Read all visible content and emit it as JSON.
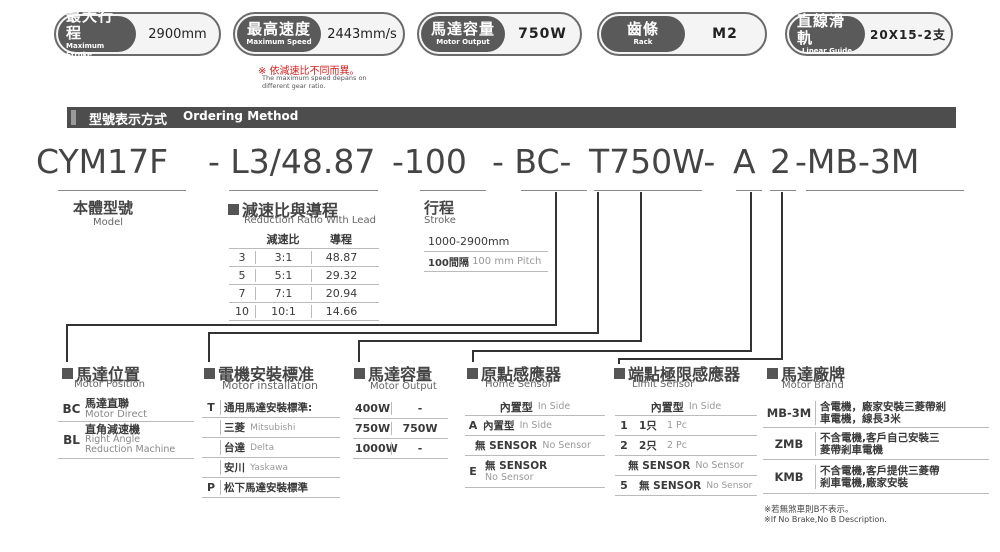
{
  "specs": [
    {
      "label": "最大行程",
      "label_en": "Maximum Stroke",
      "value": "2900mm"
    },
    {
      "label": "最高速度",
      "label_en": "Maximum Speed",
      "value": "2443mm/s"
    },
    {
      "label": "馬達容量",
      "label_en": "Motor Output",
      "value": "750W"
    },
    {
      "label": "齒條",
      "label_en": "Rack",
      "value": "M2"
    },
    {
      "label": "直線滑軌",
      "label_en": "Linear Guide",
      "value": "20X15-2支"
    }
  ],
  "speed_note": {
    "zh": "※ 依減速比不同而異。",
    "en1": "The maximum speed depans on",
    "en2": "different gear ratio."
  },
  "ordering": {
    "zh": "型號表示方式",
    "en": "Ordering Method"
  },
  "code_parts": [
    "CYM17F",
    "- L3/48.87",
    "-100",
    "- BC-",
    "T750W-",
    "A",
    "2",
    "-MB-3M"
  ],
  "model": {
    "zh": "本體型號",
    "en": "Model"
  },
  "reduction": {
    "title": "減速比與導程",
    "sub": "Reduction Ratio With Lead",
    "headers": [
      "",
      "減速比",
      "導程"
    ],
    "rows": [
      [
        "3",
        "3:1",
        "48.87"
      ],
      [
        "5",
        "5:1",
        "29.32"
      ],
      [
        "7",
        "7:1",
        "20.94"
      ],
      [
        "10",
        "10:1",
        "14.66"
      ]
    ]
  },
  "stroke": {
    "title": "行程",
    "sub": "Stroke",
    "range": "1000-2900mm",
    "pitch_zh": "100間隔",
    "pitch_en": "100 mm Pitch"
  },
  "motor_position": {
    "title": "馬達位置",
    "sub": "Motor Position",
    "rows": [
      {
        "code": "BC",
        "zh": "馬達直聯",
        "en": "Motor Direct"
      },
      {
        "code": "BL",
        "zh": "直角減速機",
        "en": "Right Angle",
        "en2": "Reduction Machine"
      }
    ]
  },
  "motor_install": {
    "title": "電機安裝標准",
    "sub": "Motor installation",
    "rows": [
      {
        "code": "T",
        "zh": "通用馬達安裝標準:",
        "en": ""
      },
      {
        "code": "",
        "zh": "三菱",
        "en": "Mitsubishi"
      },
      {
        "code": "",
        "zh": "台達",
        "en": "Delta"
      },
      {
        "code": "",
        "zh": "安川",
        "en": "Yaskawa"
      },
      {
        "code": "P",
        "zh": "松下馬達安裝標準",
        "en": ""
      }
    ]
  },
  "motor_output": {
    "title": "馬達容量",
    "sub": "Motor Output",
    "rows": [
      [
        "400W",
        "-"
      ],
      [
        "750W",
        "750W"
      ],
      [
        "1000W",
        "-"
      ]
    ]
  },
  "home_sensor": {
    "title": "原點感應器",
    "sub": "Home Sensor",
    "header_zh": "內置型",
    "header_en": "In Side",
    "rows": [
      {
        "code": "A",
        "zh": "內置型",
        "en": "In Side"
      },
      {
        "code": "",
        "zh": "無 SENSOR",
        "en": "No Sensor"
      },
      {
        "code": "E",
        "zh": "無 SENSOR",
        "en": "No Sensor"
      }
    ]
  },
  "limit_sensor": {
    "title": "端點極限感應器",
    "sub": "Limit Sensor",
    "header_zh": "內置型",
    "header_en": "In Side",
    "rows": [
      {
        "code": "1",
        "zh": "1只",
        "en": "1 Pc"
      },
      {
        "code": "2",
        "zh": "2只",
        "en": "2 Pc"
      },
      {
        "code": "",
        "zh": "無 SENSOR",
        "en": "No Sensor"
      },
      {
        "code": "5",
        "zh": "無 SENSOR",
        "en": "No Sensor"
      }
    ]
  },
  "motor_brand": {
    "title": "馬達廠牌",
    "sub": "Motor Brand",
    "rows": [
      {
        "code": "MB-3M",
        "desc1": "含電機，廠家安裝三菱帶剎",
        "desc2": "車電機，線長3米"
      },
      {
        "code": "ZMB",
        "desc1": "不含電機,客戶自己安裝三",
        "desc2": "菱帶剎車電機"
      },
      {
        "code": "KMB",
        "desc1": "不含電機,客戶提供三菱帶",
        "desc2": "剎車電機,廠家安裝"
      }
    ],
    "note_zh": "※若無煞車則B不表示。",
    "note_en": "※If No Brake,No B Description."
  }
}
